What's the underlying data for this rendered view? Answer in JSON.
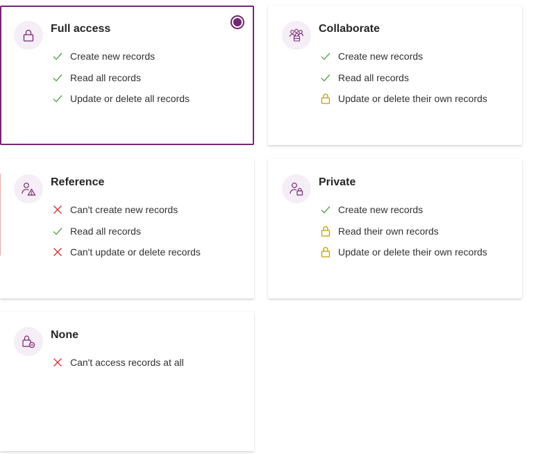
{
  "colors": {
    "accent": "#742774",
    "check": "#57a64a",
    "cross": "#d13438",
    "lock": "#c19c00",
    "icon_bg": "#f6eef6"
  },
  "cards": {
    "full_access": {
      "title": "Full access",
      "icon": "lock-icon",
      "selected": true,
      "permissions": [
        {
          "type": "check",
          "text": "Create new records"
        },
        {
          "type": "check",
          "text": "Read all records"
        },
        {
          "type": "check",
          "text": "Update or delete all records"
        }
      ]
    },
    "collaborate": {
      "title": "Collaborate",
      "icon": "people-group-icon",
      "selected": false,
      "permissions": [
        {
          "type": "check",
          "text": "Create new records"
        },
        {
          "type": "check",
          "text": "Read all records"
        },
        {
          "type": "lock",
          "text": "Update or delete their own records"
        }
      ]
    },
    "reference": {
      "title": "Reference",
      "icon": "person-warning-icon",
      "selected": false,
      "permissions": [
        {
          "type": "cross",
          "text": "Can't create new records"
        },
        {
          "type": "check",
          "text": "Read all records"
        },
        {
          "type": "cross",
          "text": "Can't update or delete records"
        }
      ]
    },
    "private": {
      "title": "Private",
      "icon": "person-lock-icon",
      "selected": false,
      "permissions": [
        {
          "type": "check",
          "text": "Create new records"
        },
        {
          "type": "lock",
          "text": "Read their own records"
        },
        {
          "type": "lock",
          "text": "Update or delete their own records"
        }
      ]
    },
    "none": {
      "title": "None",
      "icon": "lock-blocked-icon",
      "selected": false,
      "permissions": [
        {
          "type": "cross",
          "text": "Can't access records at all"
        }
      ]
    }
  }
}
